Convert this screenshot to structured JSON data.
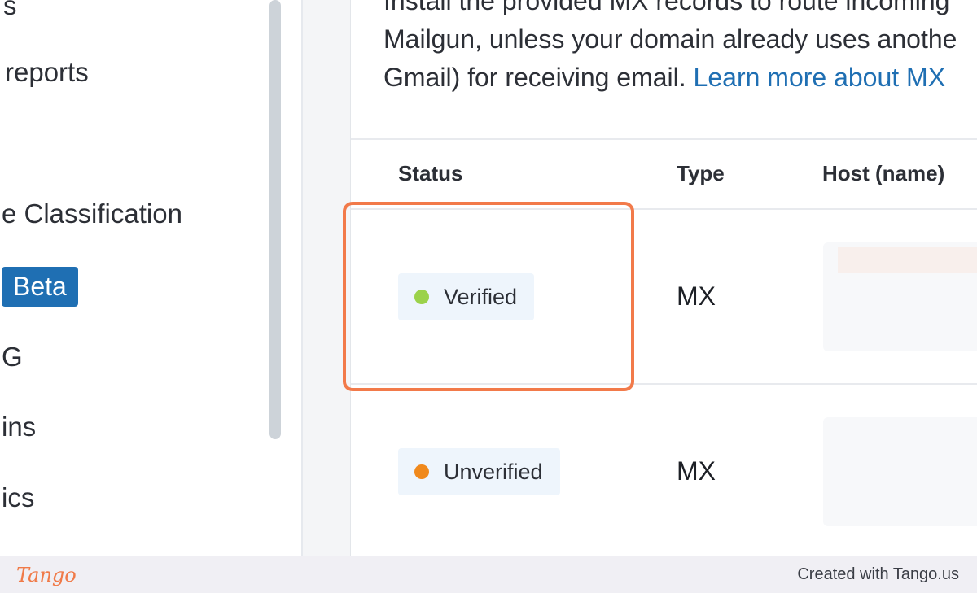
{
  "sidebar": {
    "items": [
      {
        "label": "s"
      },
      {
        "label": "reports"
      },
      {
        "label": "e Classification"
      },
      {
        "label": "G"
      },
      {
        "label": "ins"
      },
      {
        "label": "ics"
      }
    ],
    "beta_label": "Beta"
  },
  "main": {
    "description_text": "Install the provided MX records to route incoming\nMailgun, unless your domain already uses anothe\nGmail) for receiving email. ",
    "description_line1": "Install the provided MX records to route incoming",
    "description_line2": "Mailgun, unless your domain already uses anothe",
    "description_line3": "Gmail) for receiving email.",
    "learn_more_link": "Learn more about MX",
    "table": {
      "headers": {
        "status": "Status",
        "type": "Type",
        "host": "Host (name)"
      },
      "rows": [
        {
          "status": "Verified",
          "status_color": "#9bd24a",
          "type": "MX"
        },
        {
          "status": "Unverified",
          "status_color": "#f0891c",
          "type": "MX"
        }
      ]
    }
  },
  "footer": {
    "logo": "Tango",
    "credit": "Created with Tango.us"
  },
  "colors": {
    "accent": "#1f6fb3",
    "highlight": "#f27a4a",
    "verified": "#9bd24a",
    "unverified": "#f0891c"
  }
}
